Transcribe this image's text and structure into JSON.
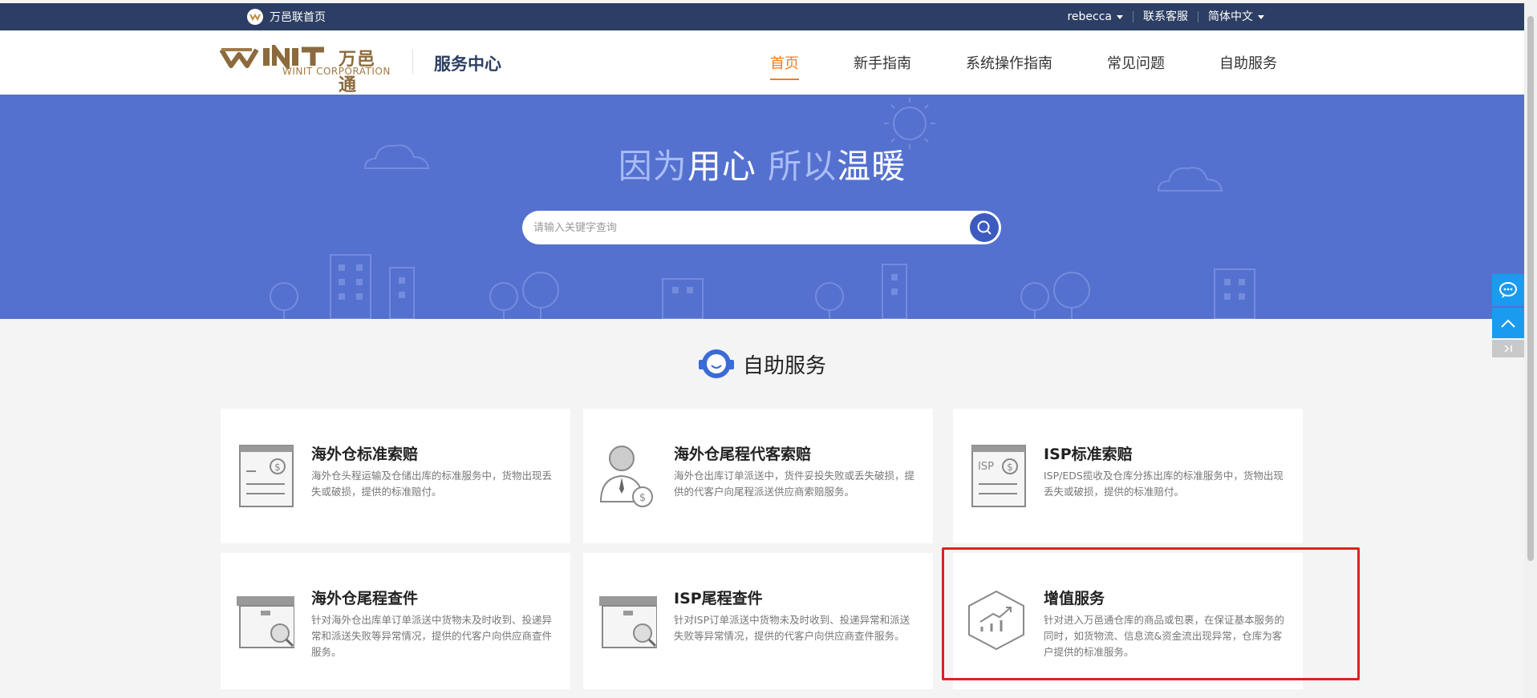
{
  "topbar": {
    "home_label": "万邑联首页",
    "user": "rebecca",
    "contact": "联系客服",
    "language": "简体中文"
  },
  "header": {
    "logo_cn": "万邑通",
    "logo_en": "WINIT CORPORATION",
    "service_center": "服务中心",
    "nav": [
      {
        "label": "首页",
        "active": true
      },
      {
        "label": "新手指南",
        "active": false
      },
      {
        "label": "系统操作指南",
        "active": false
      },
      {
        "label": "常见问题",
        "active": false
      },
      {
        "label": "自助服务",
        "active": false
      }
    ]
  },
  "hero": {
    "slogan_part1": "因为",
    "slogan_part2": "用心",
    "slogan_part3": " 所以",
    "slogan_part4": "温暖",
    "search_placeholder": "请输入关键字查询"
  },
  "section": {
    "title": "自助服务"
  },
  "cards": [
    {
      "title": "海外仓标准索赔",
      "desc": "海外仓头程运输及仓储出库的标准服务中，货物出现丢失或破损，提供的标准赔付。",
      "icon": "claim-document-icon"
    },
    {
      "title": "海外仓尾程代客索赔",
      "desc": "海外仓出库订单派送中，货件妥投失败或丢失破损，提供的代客户向尾程派送供应商索赔服务。",
      "icon": "agent-claim-icon"
    },
    {
      "title": "ISP标准索赔",
      "desc": "ISP/EDS揽收及仓库分拣出库的标准服务中，货物出现丢失或破损，提供的标准赔付。",
      "icon": "isp-claim-icon"
    },
    {
      "title": "海外仓尾程查件",
      "desc": "针对海外仓出库单订单派送中货物未及时收到、投递异常和派送失败等异常情况，提供的代客户向供应商查件服务。",
      "icon": "parcel-search-icon"
    },
    {
      "title": "ISP尾程查件",
      "desc": "针对ISP订单派送中货物未及时收到、投递异常和派送失败等异常情况，提供的代客户向供应商查件服务。",
      "icon": "isp-parcel-search-icon"
    },
    {
      "title": "增值服务",
      "desc": "针对进入万邑通仓库的商品或包裹，在保证基本服务的同时，如货物流、信息流&资金流出现异常，仓库为客户提供的标准服务。",
      "icon": "value-added-icon"
    }
  ],
  "colors": {
    "topbar": "#2c3e63",
    "hero": "#5471cf",
    "accent": "#f07e1b",
    "highlight": "#e02020",
    "side_widget": "#1a9bf0"
  }
}
